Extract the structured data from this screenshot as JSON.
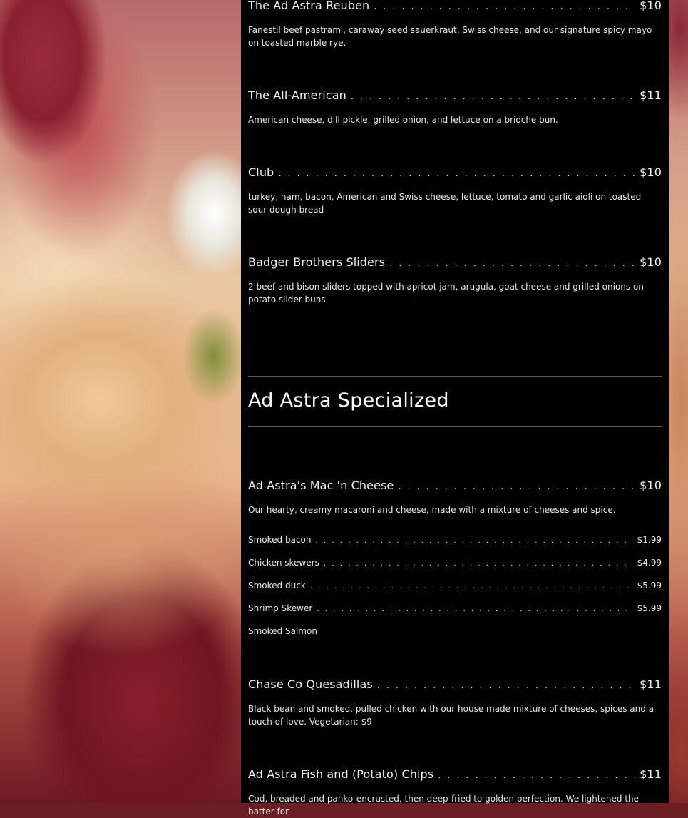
{
  "items_top": [
    {
      "name": "The Ad Astra Reuben",
      "price": "$10",
      "description": "Fanestil beef pastrami, caraway seed sauerkraut, Swiss cheese, and our signature spicy mayo on toasted marble rye."
    },
    {
      "name": "The All-American",
      "price": "$11",
      "description": "American cheese, dill pickle, grilled onion, and lettuce on a brioche bun."
    },
    {
      "name": "Club",
      "price": "$10",
      "description": "turkey, ham, bacon, American and Swiss cheese, lettuce, tomato and garlic aioli on toasted sour dough bread"
    },
    {
      "name": "Badger Brothers Sliders",
      "price": "$10",
      "description": "2 beef and bison sliders topped with apricot jam, arugula, goat cheese and grilled onions on potato slider buns"
    }
  ],
  "section": {
    "title": "Ad Astra Specialized"
  },
  "mac": {
    "name": "Ad Astra's Mac 'n Cheese",
    "price": "$10",
    "description": "Our hearty, creamy macaroni and cheese, made with a mixture of cheeses and spice.",
    "addons": [
      {
        "name": "Smoked bacon",
        "price": "$1.99"
      },
      {
        "name": "Chicken skewers",
        "price": "$4.99"
      },
      {
        "name": "Smoked duck",
        "price": "$5.99"
      },
      {
        "name": "Shrimp Skewer",
        "price": "$5.99"
      },
      {
        "name": "Smoked Salmon",
        "price": ""
      }
    ]
  },
  "items_bottom": [
    {
      "name": "Chase Co Quesadillas",
      "price": "$11",
      "description": "Black bean and smoked, pulled chicken with our house made mixture of cheeses, spices and a touch of love. Vegetarian: $9"
    },
    {
      "name": "Ad Astra Fish and (Potato) Chips",
      "price": "$11",
      "description": "Cod, breaded and panko-encrusted, then deep-fried to golden perfection. We lightened the batter for"
    }
  ],
  "colors": {
    "panel": "#000000",
    "text": "#ffffff",
    "rule": "#5b5b5b"
  }
}
